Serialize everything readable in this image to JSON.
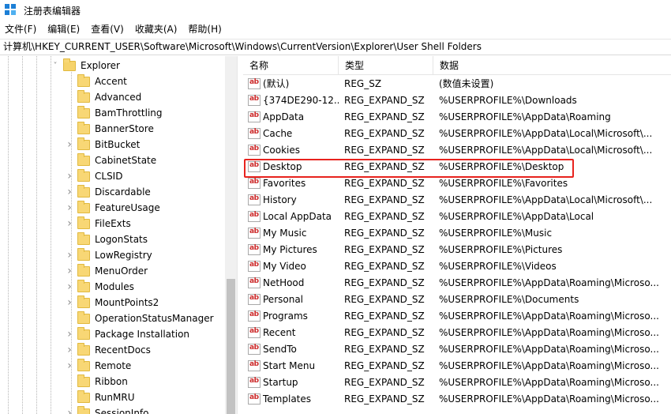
{
  "window": {
    "title": "注册表编辑器",
    "icon": "registry-editor-icon"
  },
  "menu": [
    "文件(F)",
    "编辑(E)",
    "查看(V)",
    "收藏夹(A)",
    "帮助(H)"
  ],
  "address": "计算机\\HKEY_CURRENT_USER\\Software\\Microsoft\\Windows\\CurrentVersion\\Explorer\\User Shell Folders",
  "tree": {
    "selected_parent": "Explorer",
    "items": [
      {
        "label": "Explorer",
        "expanded": true,
        "level": 0
      },
      {
        "label": "Accent",
        "level": 1,
        "has_children": false
      },
      {
        "label": "Advanced",
        "level": 1,
        "has_children": false
      },
      {
        "label": "BamThrottling",
        "level": 1,
        "has_children": false
      },
      {
        "label": "BannerStore",
        "level": 1,
        "has_children": false
      },
      {
        "label": "BitBucket",
        "level": 1,
        "has_children": true
      },
      {
        "label": "CabinetState",
        "level": 1,
        "has_children": false
      },
      {
        "label": "CLSID",
        "level": 1,
        "has_children": true
      },
      {
        "label": "Discardable",
        "level": 1,
        "has_children": true
      },
      {
        "label": "FeatureUsage",
        "level": 1,
        "has_children": true
      },
      {
        "label": "FileExts",
        "level": 1,
        "has_children": true
      },
      {
        "label": "LogonStats",
        "level": 1,
        "has_children": false
      },
      {
        "label": "LowRegistry",
        "level": 1,
        "has_children": true
      },
      {
        "label": "MenuOrder",
        "level": 1,
        "has_children": true
      },
      {
        "label": "Modules",
        "level": 1,
        "has_children": true
      },
      {
        "label": "MountPoints2",
        "level": 1,
        "has_children": true
      },
      {
        "label": "OperationStatusManager",
        "level": 1,
        "has_children": false
      },
      {
        "label": "Package Installation",
        "level": 1,
        "has_children": true
      },
      {
        "label": "RecentDocs",
        "level": 1,
        "has_children": true
      },
      {
        "label": "Remote",
        "level": 1,
        "has_children": true
      },
      {
        "label": "Ribbon",
        "level": 1,
        "has_children": false
      },
      {
        "label": "RunMRU",
        "level": 1,
        "has_children": false
      },
      {
        "label": "SessionInfo",
        "level": 1,
        "has_children": true
      }
    ]
  },
  "list": {
    "headers": {
      "name": "名称",
      "type": "类型",
      "data": "数据"
    },
    "highlight_row": "Desktop",
    "highlight_color": "#e8231e",
    "rows": [
      {
        "name": "(默认)",
        "type": "REG_SZ",
        "data": "(数值未设置)"
      },
      {
        "name": "{374DE290-12...",
        "type": "REG_EXPAND_SZ",
        "data": "%USERPROFILE%\\Downloads"
      },
      {
        "name": "AppData",
        "type": "REG_EXPAND_SZ",
        "data": "%USERPROFILE%\\AppData\\Roaming"
      },
      {
        "name": "Cache",
        "type": "REG_EXPAND_SZ",
        "data": "%USERPROFILE%\\AppData\\Local\\Microsoft\\..."
      },
      {
        "name": "Cookies",
        "type": "REG_EXPAND_SZ",
        "data": "%USERPROFILE%\\AppData\\Local\\Microsoft\\..."
      },
      {
        "name": "Desktop",
        "type": "REG_EXPAND_SZ",
        "data": "%USERPROFILE%\\Desktop"
      },
      {
        "name": "Favorites",
        "type": "REG_EXPAND_SZ",
        "data": "%USERPROFILE%\\Favorites"
      },
      {
        "name": "History",
        "type": "REG_EXPAND_SZ",
        "data": "%USERPROFILE%\\AppData\\Local\\Microsoft\\..."
      },
      {
        "name": "Local AppData",
        "type": "REG_EXPAND_SZ",
        "data": "%USERPROFILE%\\AppData\\Local"
      },
      {
        "name": "My Music",
        "type": "REG_EXPAND_SZ",
        "data": "%USERPROFILE%\\Music"
      },
      {
        "name": "My Pictures",
        "type": "REG_EXPAND_SZ",
        "data": "%USERPROFILE%\\Pictures"
      },
      {
        "name": "My Video",
        "type": "REG_EXPAND_SZ",
        "data": "%USERPROFILE%\\Videos"
      },
      {
        "name": "NetHood",
        "type": "REG_EXPAND_SZ",
        "data": "%USERPROFILE%\\AppData\\Roaming\\Microso..."
      },
      {
        "name": "Personal",
        "type": "REG_EXPAND_SZ",
        "data": "%USERPROFILE%\\Documents"
      },
      {
        "name": "Programs",
        "type": "REG_EXPAND_SZ",
        "data": "%USERPROFILE%\\AppData\\Roaming\\Microso..."
      },
      {
        "name": "Recent",
        "type": "REG_EXPAND_SZ",
        "data": "%USERPROFILE%\\AppData\\Roaming\\Microso..."
      },
      {
        "name": "SendTo",
        "type": "REG_EXPAND_SZ",
        "data": "%USERPROFILE%\\AppData\\Roaming\\Microso..."
      },
      {
        "name": "Start Menu",
        "type": "REG_EXPAND_SZ",
        "data": "%USERPROFILE%\\AppData\\Roaming\\Microso..."
      },
      {
        "name": "Startup",
        "type": "REG_EXPAND_SZ",
        "data": "%USERPROFILE%\\AppData\\Roaming\\Microso..."
      },
      {
        "name": "Templates",
        "type": "REG_EXPAND_SZ",
        "data": "%USERPROFILE%\\AppData\\Roaming\\Microso..."
      }
    ]
  }
}
